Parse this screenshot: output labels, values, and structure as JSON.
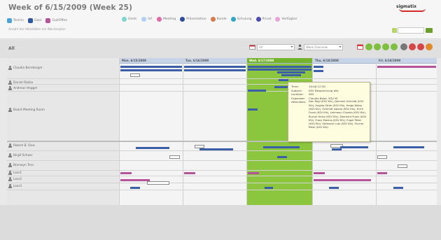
{
  "header": {
    "title": "Week of 6/15/2009 (Week 25)",
    "logo": "sigmatix",
    "subtitle": "Anzahl der Aktivitäten am Wochenplan"
  },
  "legend": {
    "items": [
      {
        "label": "Termin",
        "color": "#4aa3d8"
      },
      {
        "label": "Gast",
        "color": "#2f56a0"
      },
      {
        "label": "Gut/Offen",
        "color": "#b5539b"
      }
    ],
    "right_items": [
      {
        "label": "Gestr.",
        "color": "#7ed6cf"
      },
      {
        "label": "Inf.",
        "color": "#b0d0f0"
      },
      {
        "label": "Meeting",
        "color": "#e06aa6"
      },
      {
        "label": "Präsentation",
        "color": "#2e4a9a"
      },
      {
        "label": "Kunde",
        "color": "#d77a4b"
      },
      {
        "label": "Schulung",
        "color": "#33a6c5"
      },
      {
        "label": "Privat",
        "color": "#4b4bb0"
      },
      {
        "label": "Verfügbar",
        "color": "#e8a6d8"
      }
    ]
  },
  "toolbar": {
    "all_label": "All",
    "select1": "All",
    "select2": "Week Overview"
  },
  "days": [
    {
      "label": "Mon. 6/15/2009",
      "today": false
    },
    {
      "label": "Tue. 6/16/2009",
      "today": false
    },
    {
      "label": "Wed. 6/17/2009",
      "today": true
    },
    {
      "label": "Thu. 6/18/2009",
      "today": false
    },
    {
      "label": "Fri. 6/19/2009",
      "today": false
    }
  ],
  "resources": [
    {
      "name": "Claudia Bernberger"
    },
    {
      "name": "Daniel Staiko"
    },
    {
      "name": "Andreas Heggel"
    },
    {
      "name": "Board Meeting Room"
    },
    {
      "name": "Robert B. Dow"
    },
    {
      "name": "Birgit Schaer"
    },
    {
      "name": "Bronwyn Tero"
    },
    {
      "name": "Lear1"
    },
    {
      "name": "Lear2"
    },
    {
      "name": "Lear3"
    }
  ],
  "tooltip": {
    "time_key": "Time:",
    "time_val": "10:00-12:30",
    "subject_key": "Subject:",
    "subject_val": "KSV Besprechung alle",
    "location_key": "Location:",
    "location_val": "SKS",
    "organizer_key": "Organizer:",
    "organizer_val": "Claudia Baier, KSV Kf",
    "attendees_key": "Attendees:",
    "attendees_val": "Dan Regl (KSV Kfz), Dominik Schmidt (KSV Kfz), Angela Stroh (KSV Kfz), Helga Weiss (KSV Kfz), Schmidt Sabine (KSV Kfz), Erich Frank (KSV Kfz), Lehmann Claudia (KSV Kfz), Burner Heinz (KSV Kfz), Eberhard Frank (KSV Kfz), Franz Markus (KSV Kfz), Engel Peter (KSV Kfz), Hofmann Lutz (KSV Kfz), Fischer Peter (KSV Kfz)"
  }
}
